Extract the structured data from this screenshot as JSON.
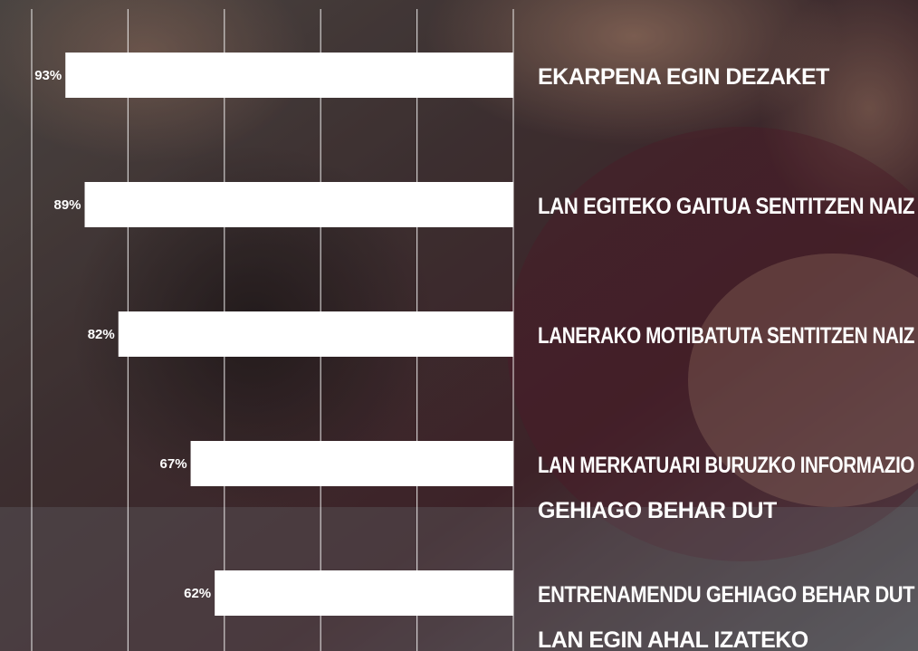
{
  "chart_data": {
    "type": "bar",
    "orientation": "horizontal",
    "categories": [
      "EKARPENA EGIN DEZAKET",
      "LAN EGITEKO GAITUA SENTITZEN NAIZ",
      "LANERAKO MOTIBATUTA SENTITZEN NAIZ",
      "LAN MERKATUARI BURUZKO INFORMAZIO GEHIAGO BEHAR DUT",
      "ENTRENAMENDU GEHIAGO BEHAR DUT LAN EGIN AHAL IZATEKO"
    ],
    "category_lines": [
      [
        "EKARPENA EGIN DEZAKET"
      ],
      [
        "LAN EGITEKO GAITUA SENTITZEN NAIZ"
      ],
      [
        "LANERAKO MOTIBATUTA SENTITZEN NAIZ"
      ],
      [
        "LAN MERKATUARI BURUZKO INFORMAZIO",
        "GEHIAGO BEHAR DUT"
      ],
      [
        "ENTRENAMENDU GEHIAGO BEHAR DUT",
        "LAN EGIN AHAL IZATEKO"
      ]
    ],
    "values": [
      93,
      89,
      82,
      67,
      62
    ],
    "value_labels": [
      "93%",
      "89%",
      "82%",
      "67%",
      "62%"
    ],
    "xlim": [
      0,
      100
    ],
    "direction": "right-to-left",
    "grid": true,
    "title": "",
    "xlabel": "",
    "ylabel": ""
  },
  "colors": {
    "bar": "#ffffff",
    "grid": "#ffffff",
    "text": "#ffffff",
    "background": "#3a2f31"
  },
  "background_image": "photo of smiling students (decorative)"
}
